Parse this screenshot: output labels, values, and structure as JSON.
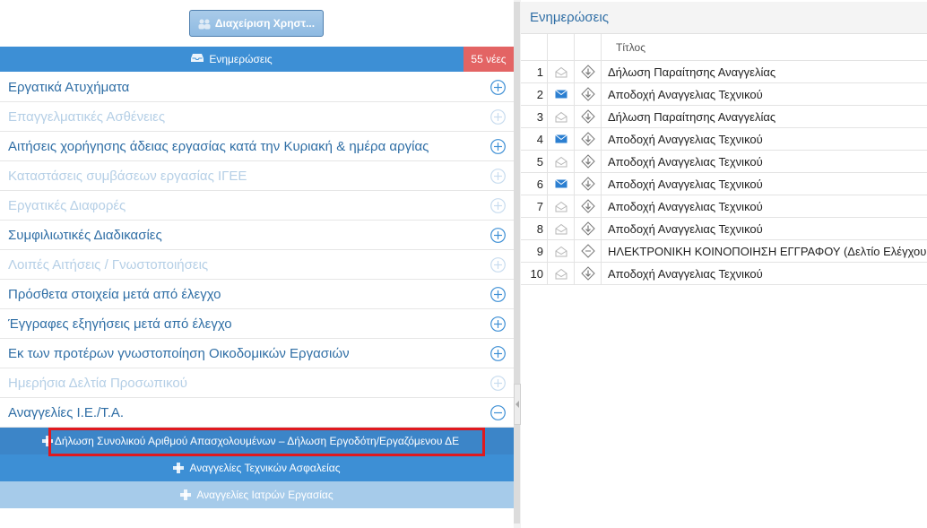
{
  "left": {
    "user_mgmt_label": "Διαχείριση Χρηστ...",
    "updates_label": "Ενημερώσεις",
    "new_badge": "55 νέες",
    "categories": [
      {
        "label": "Εργατικά Ατυχήματα",
        "enabled": true,
        "state": "plus"
      },
      {
        "label": "Επαγγελματικές Ασθένειες",
        "enabled": false,
        "state": "plus"
      },
      {
        "label": "Αιτήσεις χορήγησης άδειας εργασίας κατά την Κυριακή & ημέρα αργίας",
        "enabled": true,
        "state": "plus"
      },
      {
        "label": "Καταστάσεις συμβάσεων εργασίας ΙΓΕΕ",
        "enabled": false,
        "state": "plus"
      },
      {
        "label": "Εργατικές Διαφορές",
        "enabled": false,
        "state": "plus"
      },
      {
        "label": "Συμφιλιωτικές Διαδικασίες",
        "enabled": true,
        "state": "plus"
      },
      {
        "label": "Λοιπές Αιτήσεις / Γνωστοποιήσεις",
        "enabled": false,
        "state": "plus"
      },
      {
        "label": "Πρόσθετα στοιχεία μετά από έλεγχο",
        "enabled": true,
        "state": "plus"
      },
      {
        "label": "Έγγραφες εξηγήσεις μετά από έλεγχο",
        "enabled": true,
        "state": "plus"
      },
      {
        "label": "Εκ των προτέρων γνωστοποίηση Οικοδομικών Εργασιών",
        "enabled": true,
        "state": "plus"
      },
      {
        "label": "Ημερήσια Δελτία Προσωπικού",
        "enabled": false,
        "state": "plus"
      },
      {
        "label": "Αναγγελίες Ι.Ε./Τ.Α.",
        "enabled": true,
        "state": "minus"
      }
    ],
    "subitems": {
      "s1": "Δήλωση Συνολικού Αριθμού Απασχολουμένων – Δήλωση Εργοδότη/Εργαζόμενου ΔΕ",
      "s2": "Αναγγελίες Τεχνικών Ασφαλείας",
      "s3": "Αναγγελίες Ιατρών Εργασίας"
    }
  },
  "right": {
    "title": "Ενημερώσεις",
    "column_title": "Τίτλος",
    "rows": [
      {
        "num": "1",
        "read": true,
        "title": "Δήλωση Παραίτησης Αναγγελίας"
      },
      {
        "num": "2",
        "read": false,
        "title": "Αποδοχή Αναγγελιας Τεχνικού"
      },
      {
        "num": "3",
        "read": true,
        "title": "Δήλωση Παραίτησης Αναγγελίας"
      },
      {
        "num": "4",
        "read": false,
        "title": "Αποδοχή Αναγγελιας Τεχνικού"
      },
      {
        "num": "5",
        "read": true,
        "title": "Αποδοχή Αναγγελιας Τεχνικού"
      },
      {
        "num": "6",
        "read": false,
        "title": "Αποδοχή Αναγγελιας Τεχνικού"
      },
      {
        "num": "7",
        "read": true,
        "title": "Αποδοχή Αναγγελιας Τεχνικού"
      },
      {
        "num": "8",
        "read": true,
        "title": "Αποδοχή Αναγγελιας Τεχνικού"
      },
      {
        "num": "9",
        "read": true,
        "title": "ΗΛΕΚΤΡΟΝΙΚΗ ΚΟΙΝΟΠΟΙΗΣΗ ΕΓΓΡΑΦΟΥ (Δελτίο Ελέγχου"
      },
      {
        "num": "10",
        "read": true,
        "title": "Αποδοχή Αναγγελιας Τεχνικού"
      }
    ]
  },
  "colors": {
    "accent": "#3d8fd5",
    "badge": "#e36464",
    "link": "#2f6ea5",
    "highlight": "#e0191f",
    "unread_env": "#2b7fd1"
  },
  "icons": {
    "user": "users-icon",
    "inbox": "inbox-icon",
    "expand": "circle-plus-icon",
    "collapse": "circle-minus-icon",
    "envelope": "envelope-icon",
    "download": "download-icon"
  }
}
